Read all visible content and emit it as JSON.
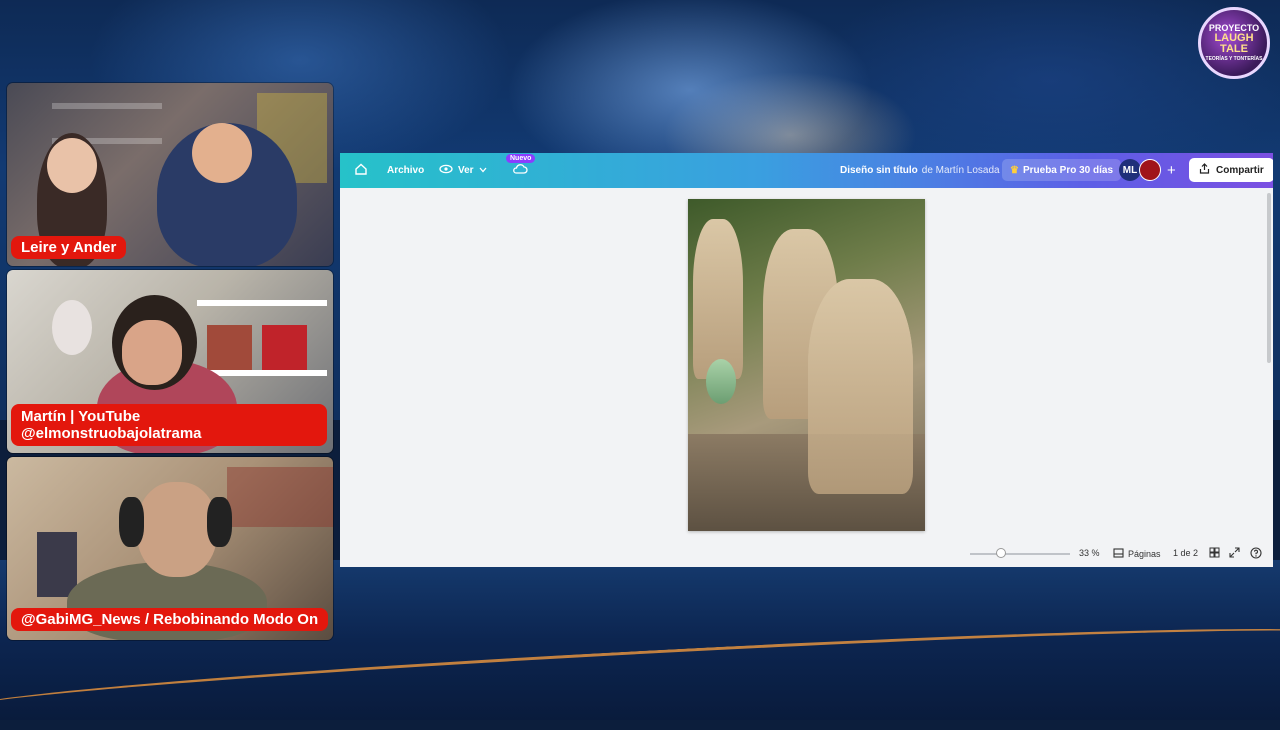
{
  "logo": {
    "line1": "PROYECTO",
    "line2": "LAUGH TALE",
    "line3": "TEORÍAS Y TONTERÍAS"
  },
  "cams": [
    {
      "label": "Leire y Ander"
    },
    {
      "label_line1": "Martín | YouTube",
      "label_line2": "@elmonstruobajolatrama"
    },
    {
      "label": "@GabiMG_News / Rebobinando Modo On"
    }
  ],
  "canva": {
    "archivo": "Archivo",
    "ver": "Ver",
    "nuevo": "Nuevo",
    "doc_title": "Diseño sin título",
    "doc_owner": "de Martín Losada",
    "pro_trial": "Prueba Pro 30 días",
    "avatar_initials": "ML",
    "share": "Compartir",
    "zoom": "33 %",
    "pages_label": "Páginas",
    "page_count": "1 de 2",
    "zoom_fraction": 0.33
  },
  "colors": {
    "nameplate": "#e3170d",
    "topbar_start": "#26c2c9",
    "topbar_end": "#7b4fe2",
    "pro_badge": "#8b3dff"
  },
  "icons": [
    "home-icon",
    "eye-icon",
    "chevron-down-icon",
    "cloud-sync-icon",
    "crown-icon",
    "plus-icon",
    "share-icon",
    "pages-icon",
    "grid-view-icon",
    "fullscreen-icon",
    "help-icon"
  ]
}
